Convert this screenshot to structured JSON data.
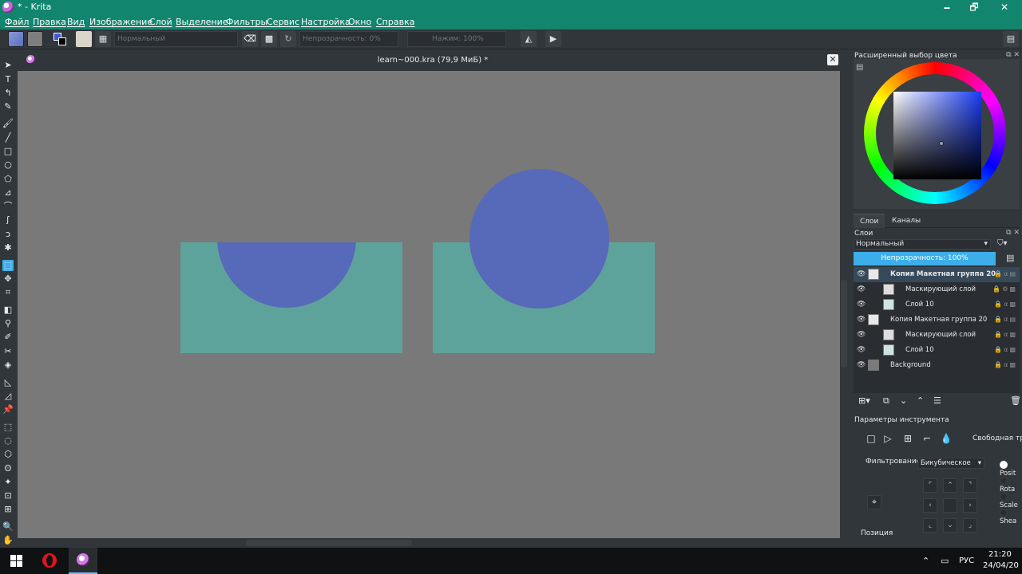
{
  "window": {
    "title": "* - Krita",
    "minimize": "🗕",
    "maximize": "🗗",
    "close": "✕"
  },
  "menu": [
    "Файл",
    "Правка",
    "Вид",
    "Изображение",
    "Слой",
    "Выделение",
    "Фильтры",
    "Сервис",
    "Настройка",
    "Окно",
    "Справка"
  ],
  "toolbar": {
    "blend_mode": "Нормальный",
    "opacity": "Непрозрачность: 0%",
    "pressure": "Нажим: 100%"
  },
  "document": {
    "tab_title": "learn~000.kra (79,9 МиБ) *",
    "close": "✕"
  },
  "colors": {
    "accent": "#3daee9",
    "titlebar": "#12856f",
    "canvas_bg": "#797979",
    "shape_rect": "#5ea39b",
    "shape_circle": "#5769b9"
  },
  "dockers": {
    "color_selector_title": "Расширенный выбор цвета",
    "tabs": [
      "Слои",
      "Каналы"
    ],
    "layers_title": "Слои",
    "layer_blend": "Нормальный",
    "layer_opacity": "Непрозрачность:  100%",
    "layers": [
      {
        "name": "Копия  Макетная группа 20",
        "bold": true,
        "indent": 0,
        "selected": true
      },
      {
        "name": "Маскирующий слой",
        "indent": 1
      },
      {
        "name": "Слой 10",
        "indent": 1
      },
      {
        "name": "Копия  Макетная группа 20",
        "indent": 0
      },
      {
        "name": "Маскирующий слой",
        "indent": 1
      },
      {
        "name": "Слой 10",
        "indent": 1
      },
      {
        "name": "Background",
        "indent": 0
      }
    ],
    "tool_options_title": "Параметры инструмента",
    "transform_label": "Свободная тран",
    "filter_label": "Фильтрование:",
    "filter_value": "Бикубическое",
    "radios": [
      "Posit",
      "Rota",
      "Scale",
      "Shea"
    ],
    "position_label": "Позиция"
  },
  "taskbar": {
    "lang": "РУС",
    "time": "21:20",
    "date": "24/04/20"
  }
}
